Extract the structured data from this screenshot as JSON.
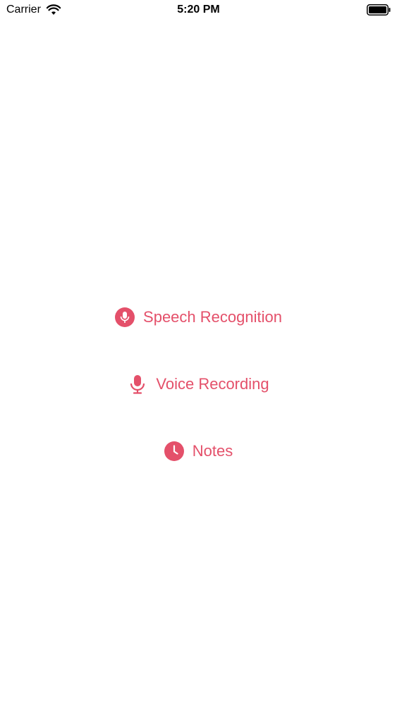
{
  "status_bar": {
    "carrier": "Carrier",
    "time": "5:20 PM",
    "wifi_icon": "wifi-icon",
    "battery_icon": "battery-icon"
  },
  "menu": {
    "accent_color": "#e4506a",
    "items": [
      {
        "label": "Speech Recognition",
        "icon": "mic-circle-icon"
      },
      {
        "label": "Voice Recording",
        "icon": "mic-icon"
      },
      {
        "label": "Notes",
        "icon": "clock-icon"
      }
    ]
  }
}
